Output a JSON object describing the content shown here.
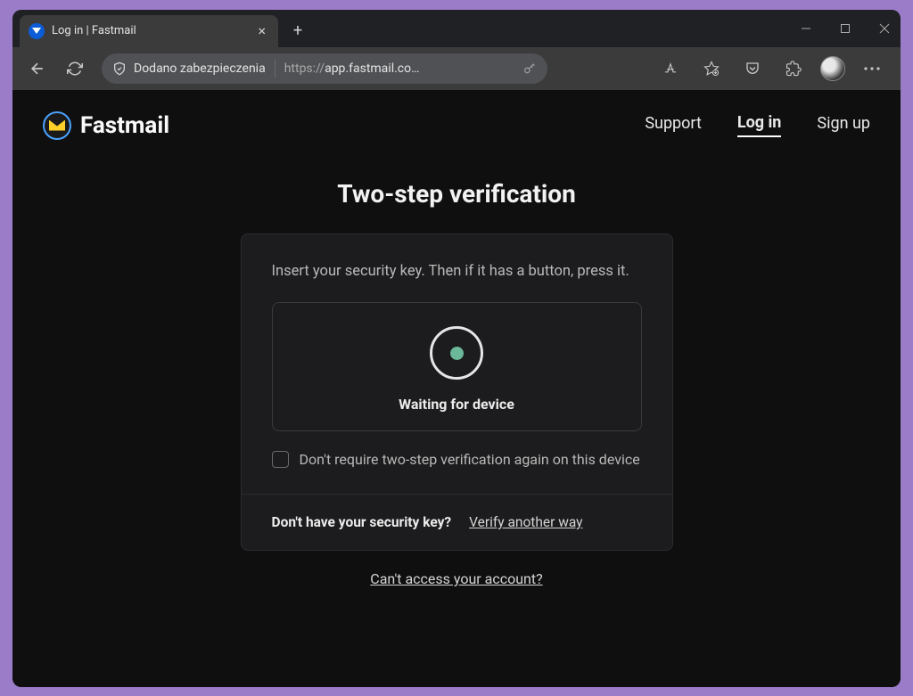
{
  "browser": {
    "tab_title": "Log in | Fastmail",
    "security_label": "Dodano zabezpieczenia",
    "url_display": "https://app.fastmail.co…",
    "url_protocol": "https://",
    "url_host": "app.fastmail.co…"
  },
  "header": {
    "brand": "Fastmail",
    "nav": {
      "support": "Support",
      "login": "Log in",
      "signup": "Sign up"
    }
  },
  "main": {
    "title": "Two-step verification",
    "instruction": "Insert your security key. Then if it has a button, press it.",
    "waiting": "Waiting for device",
    "dont_require": "Don't require two-step verification again on this device",
    "footer_question": "Don't have your security key?",
    "footer_link": "Verify another way",
    "bottom_link": "Can't access your account?"
  }
}
